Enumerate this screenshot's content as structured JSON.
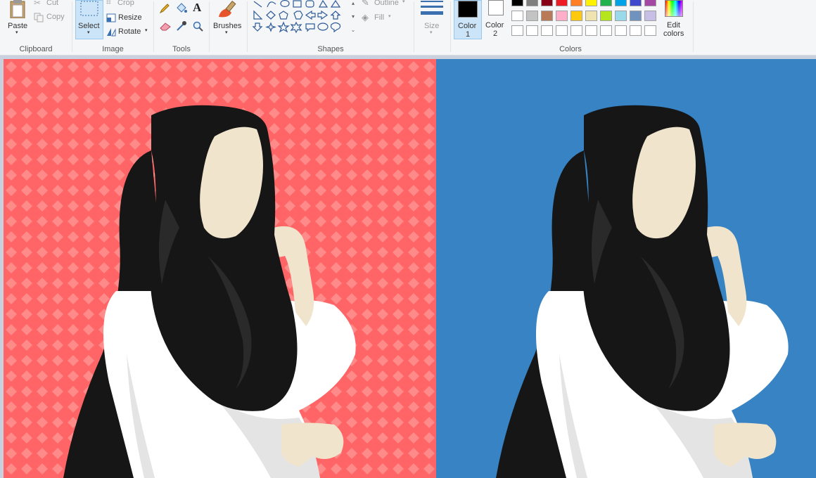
{
  "clipboard": {
    "group_label": "Clipboard",
    "paste_label": "Paste",
    "cut_label": "Cut",
    "copy_label": "Copy"
  },
  "image": {
    "group_label": "Image",
    "select_label": "Select",
    "crop_label": "Crop",
    "resize_label": "Resize",
    "rotate_label": "Rotate"
  },
  "tools": {
    "group_label": "Tools"
  },
  "brushes": {
    "label": "Brushes"
  },
  "shapes": {
    "group_label": "Shapes",
    "outline_label": "Outline",
    "fill_label": "Fill"
  },
  "size": {
    "label": "Size"
  },
  "colors": {
    "group_label": "Colors",
    "color1_label": "Color",
    "color1_num": "1",
    "color2_label": "Color",
    "color2_num": "2",
    "edit_label": "Edit",
    "edit_label2": "colors",
    "color1_value": "#000000",
    "color2_value": "#ffffff",
    "palette_row1": [
      "#000000",
      "#7f7f7f",
      "#880015",
      "#ed1c24",
      "#ff7f27",
      "#fff200",
      "#22b14c",
      "#00a2e8",
      "#3f48cc",
      "#a349a4"
    ],
    "palette_row2": [
      "#ffffff",
      "#c3c3c3",
      "#b97a57",
      "#ffaec9",
      "#ffc90e",
      "#efe4b0",
      "#b5e61d",
      "#99d9ea",
      "#7092be",
      "#c8bfe7"
    ],
    "palette_row3": [
      "#ffffff",
      "#ffffff",
      "#ffffff",
      "#ffffff",
      "#ffffff",
      "#ffffff",
      "#ffffff",
      "#ffffff",
      "#ffffff",
      "#ffffff"
    ]
  },
  "canvas": {
    "left_bg": "#ff6566",
    "right_bg": "#3783c3",
    "hijab": "#161616",
    "skin": "#f0e4cc",
    "cloth": "#ffffff"
  }
}
